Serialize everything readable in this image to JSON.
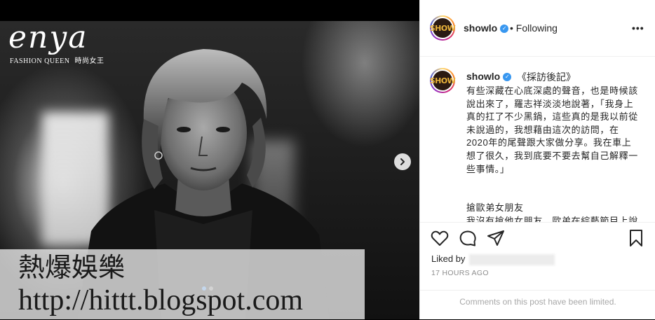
{
  "magazine": {
    "logo_word": "enya",
    "logo_sub": "FASHION QUEEN",
    "logo_sub_cn": "時尚女王"
  },
  "carousel": {
    "dot_count": 2,
    "active_index": 0
  },
  "watermark": {
    "line1": "熱爆娛樂",
    "line2": "http://hittt.blogspot.com"
  },
  "post_header": {
    "username": "showlo",
    "separator": "•",
    "follow_status": "Following",
    "avatar_text": "SHOW"
  },
  "caption": {
    "username": "showlo",
    "title": "《採訪後記》",
    "paragraph1": "有些深藏在心底深處的聲音，也是時候該說出來了，羅志祥淡淡地說著，「我身上真的扛了不少黑鍋，這些真的是我以前從未說過的，我想藉由這次的訪問，在2020年的尾聲跟大家做分享。我在車上想了很久，我到底要不要去幫自己解釋一些事情。」",
    "paragraph2_title": "搶歐弟女朋友",
    "paragraph2": "我沒有搶他女朋友，歐弟在綜藝節目上說他在當兵前把女友交給他最好的兄弟"
  },
  "footer": {
    "liked_by_label": "Liked by",
    "timestamp": "17 HOURS AGO",
    "comments_notice": "Comments on this post have been limited."
  },
  "colors": {
    "verified_blue": "#3897f0",
    "dot_active": "#3b93f5",
    "muted_text": "#8e8e8e"
  }
}
